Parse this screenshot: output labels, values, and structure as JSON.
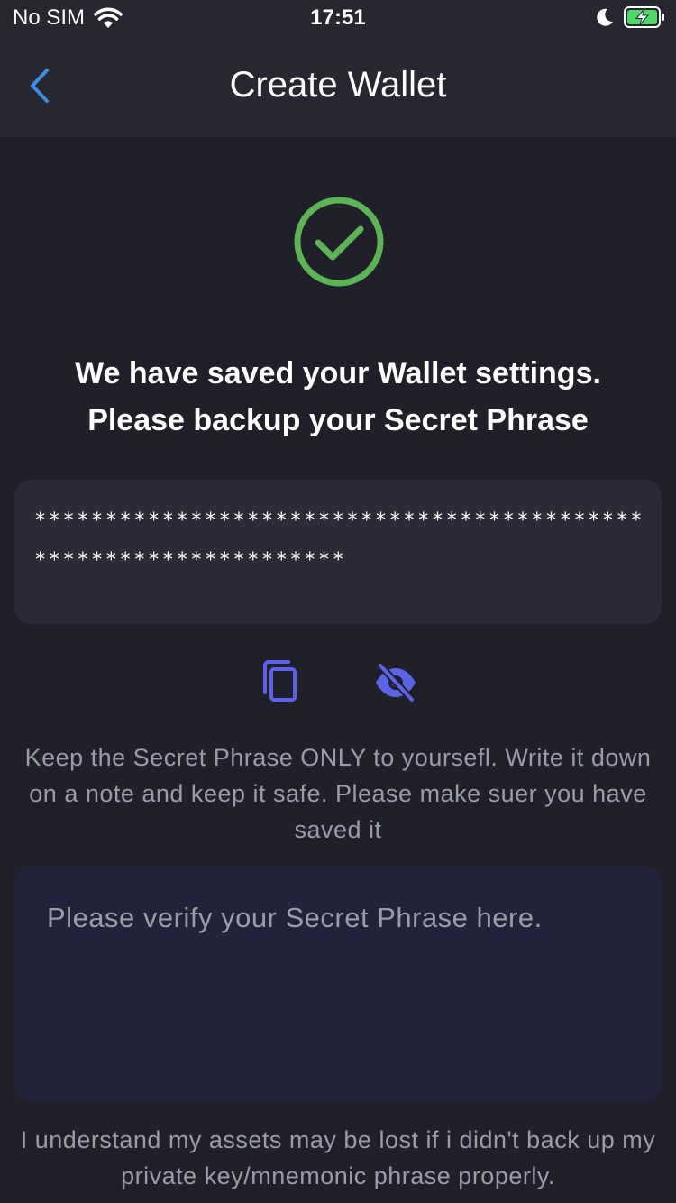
{
  "status_bar": {
    "carrier": "No SIM",
    "time": "17:51",
    "battery_color": "#4cd964"
  },
  "nav": {
    "back_icon": "chevron-left-icon",
    "title": "Create Wallet",
    "accent_color": "#3b8fe0"
  },
  "success": {
    "icon": "check-circle-icon",
    "color": "#5ab552",
    "heading_line1": "We have saved your Wallet settings.",
    "heading_line2": "Please backup your Secret Phrase"
  },
  "secret_phrase": {
    "masked_value": "*****************************************************************"
  },
  "actions": {
    "copy_icon": "copy-icon",
    "visibility_icon": "eye-off-icon",
    "icon_color": "#5b63e8"
  },
  "warning": {
    "text": "Keep the Secret Phrase ONLY to yoursefl. Write it down on a note and keep it safe. Please make suer you have saved it"
  },
  "verify": {
    "placeholder": "Please verify your Secret Phrase here."
  },
  "disclaimer": {
    "text": "I understand my assets may be lost if i didn't back up my private key/mnemonic phrase properly."
  }
}
